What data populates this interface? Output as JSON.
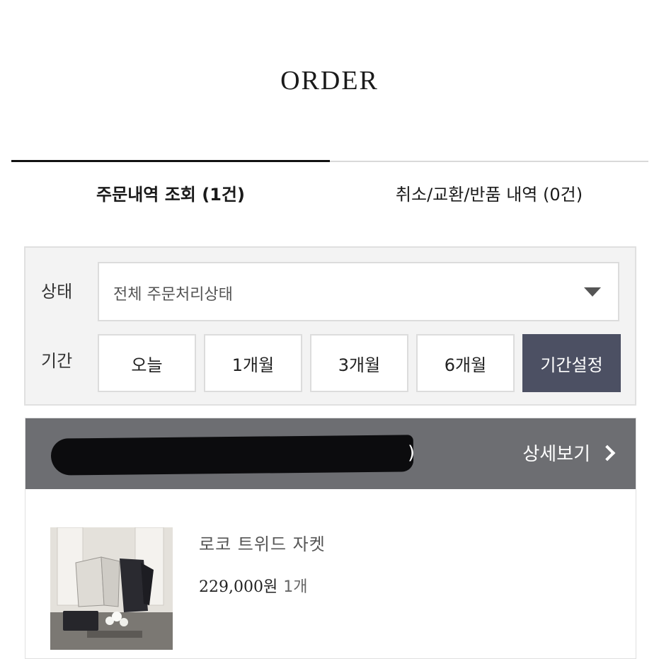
{
  "page": {
    "title": "ORDER"
  },
  "tabs": [
    {
      "label": "주문내역 조회 (1건)",
      "active": true
    },
    {
      "label": "취소/교환/반품 내역 (0건)",
      "active": false
    }
  ],
  "filters": {
    "status_label": "상태",
    "status_value": "전체 주문처리상태",
    "period_label": "기간",
    "period_buttons": [
      "오늘",
      "1개월",
      "3개월",
      "6개월",
      "기간설정"
    ],
    "active_period": "기간설정"
  },
  "order": {
    "header_suffix": ")",
    "detail_label": "상세보기",
    "product": {
      "name": "로코 트위드 자켓",
      "price": "229,000원",
      "quantity": "1개"
    }
  },
  "colors": {
    "active_button": "#4c5063",
    "order_header": "#6d6e72",
    "tab_active_line": "#111111"
  },
  "icons": {
    "select_caret": "caret-down-icon",
    "detail": "chevron-right-icon"
  }
}
